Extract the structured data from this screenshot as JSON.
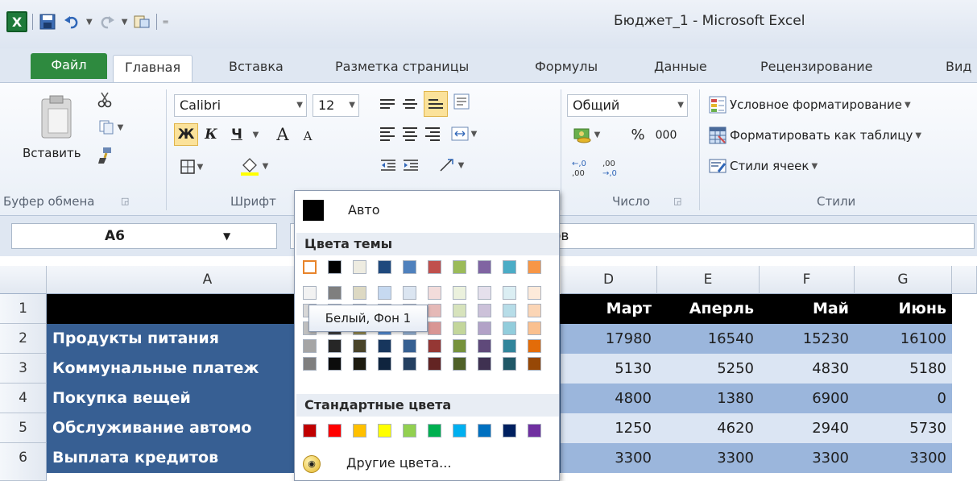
{
  "window": {
    "title": "Бюджет_1  -  Microsoft Excel"
  },
  "qat": {
    "app_icon": "X"
  },
  "tabs": [
    {
      "label": "Файл"
    },
    {
      "label": "Главная"
    },
    {
      "label": "Вставка"
    },
    {
      "label": "Разметка страницы"
    },
    {
      "label": "Формулы"
    },
    {
      "label": "Данные"
    },
    {
      "label": "Рецензирование"
    },
    {
      "label": "Вид"
    }
  ],
  "ribbon": {
    "clipboard": {
      "paste_label": "Вставить",
      "group_label": "Буфер обмена"
    },
    "font": {
      "font_name": "Calibri",
      "font_size": "12",
      "bold": "Ж",
      "italic": "К",
      "underline": "Ч",
      "grow": "A",
      "shrink": "A",
      "font_color": "A",
      "group_label": "Шрифт"
    },
    "number": {
      "format": "Общий",
      "percent": "%",
      "thousands": "000",
      "group_label": "Число"
    },
    "styles": {
      "conditional": "Условное форматирование",
      "as_table": "Форматировать как таблицу",
      "cell_styles": "Стили ячеек",
      "group_label": "Стили"
    }
  },
  "formula_bar": {
    "name_box": "A6",
    "content": "ов"
  },
  "grid": {
    "columns": [
      "A",
      "D",
      "E",
      "F",
      "G"
    ],
    "rows": [
      "1",
      "2",
      "3",
      "4",
      "5",
      "6"
    ],
    "header_row": [
      "Март",
      "Аперль",
      "Май",
      "Июнь"
    ],
    "labels": [
      "Продукты питания",
      "Коммунальные платеж",
      "Покупка вещей",
      "Обслуживание автомо",
      "Выплата кредитов"
    ],
    "values": [
      [
        "17980",
        "16540",
        "15230",
        "16100"
      ],
      [
        "5130",
        "5250",
        "4830",
        "5180"
      ],
      [
        "4800",
        "1380",
        "6900",
        "0"
      ],
      [
        "1250",
        "4620",
        "2940",
        "5730"
      ],
      [
        "3300",
        "3300",
        "3300",
        "3300"
      ]
    ]
  },
  "color_menu": {
    "auto_label": "Авто",
    "theme_title": "Цвета темы",
    "standard_title": "Стандартные цвета",
    "more_label": "Другие цвета...",
    "tooltip": "Белый, Фон 1",
    "theme_top": [
      "#ffffff",
      "#000000",
      "#eeece1",
      "#1f497d",
      "#4f81bd",
      "#c0504d",
      "#9bbb59",
      "#8064a2",
      "#4bacc6",
      "#f79646"
    ],
    "theme_shades": [
      [
        "#f2f2f2",
        "#d8d8d8",
        "#bfbfbf",
        "#a5a5a5",
        "#7f7f7f"
      ],
      [
        "#7f7f7f",
        "#595959",
        "#3f3f3f",
        "#262626",
        "#0c0c0c"
      ],
      [
        "#ddd9c3",
        "#c4bd97",
        "#938953",
        "#494429",
        "#1d1b10"
      ],
      [
        "#c6d9f0",
        "#8db3e2",
        "#548dd4",
        "#17365d",
        "#0f243e"
      ],
      [
        "#dbe5f1",
        "#b8cce4",
        "#95b3d7",
        "#366092",
        "#244061"
      ],
      [
        "#f2dcdb",
        "#e5b9b7",
        "#d99694",
        "#953734",
        "#632423"
      ],
      [
        "#ebf1dd",
        "#d7e3bc",
        "#c3d69b",
        "#76923c",
        "#4f6128"
      ],
      [
        "#e5e0ec",
        "#ccc1d9",
        "#b2a2c7",
        "#5f497a",
        "#3f3151"
      ],
      [
        "#dbeef3",
        "#b7dde8",
        "#92cddc",
        "#31859b",
        "#205867"
      ],
      [
        "#fdeada",
        "#fbd5b5",
        "#fac08f",
        "#e36c09",
        "#974806"
      ]
    ],
    "standard": [
      "#c00000",
      "#ff0000",
      "#ffc000",
      "#ffff00",
      "#92d050",
      "#00b050",
      "#00b0f0",
      "#0070c0",
      "#002060",
      "#7030a0"
    ]
  }
}
